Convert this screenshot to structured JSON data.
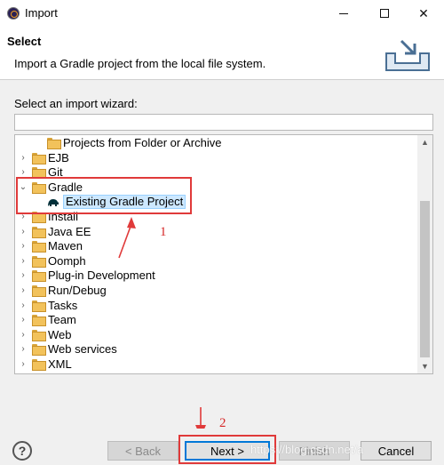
{
  "window": {
    "title": "Import",
    "minimize_icon": "minimize-icon",
    "maximize_icon": "maximize-icon",
    "close_glyph": "✕"
  },
  "header": {
    "title": "Select",
    "description": "Import a Gradle project from the local file system."
  },
  "wizard": {
    "label": "Select an import wizard:",
    "filter_value": ""
  },
  "tree": {
    "items": [
      {
        "label": "Projects from Folder or Archive",
        "level": 1,
        "twisty": "",
        "icon": "folder-icon"
      },
      {
        "label": "EJB",
        "level": 0,
        "twisty": "›",
        "icon": "folder-icon"
      },
      {
        "label": "Git",
        "level": 0,
        "twisty": "›",
        "icon": "folder-icon"
      },
      {
        "label": "Gradle",
        "level": 0,
        "twisty": "⌄",
        "icon": "folder-icon"
      },
      {
        "label": "Existing Gradle Project",
        "level": 1,
        "twisty": "",
        "icon": "gradle-elephant-icon",
        "selected": true
      },
      {
        "label": "Install",
        "level": 0,
        "twisty": "›",
        "icon": "folder-icon"
      },
      {
        "label": "Java EE",
        "level": 0,
        "twisty": "›",
        "icon": "folder-icon"
      },
      {
        "label": "Maven",
        "level": 0,
        "twisty": "›",
        "icon": "folder-icon"
      },
      {
        "label": "Oomph",
        "level": 0,
        "twisty": "›",
        "icon": "folder-icon"
      },
      {
        "label": "Plug-in Development",
        "level": 0,
        "twisty": "›",
        "icon": "folder-icon"
      },
      {
        "label": "Run/Debug",
        "level": 0,
        "twisty": "›",
        "icon": "folder-icon"
      },
      {
        "label": "Tasks",
        "level": 0,
        "twisty": "›",
        "icon": "folder-icon"
      },
      {
        "label": "Team",
        "level": 0,
        "twisty": "›",
        "icon": "folder-icon"
      },
      {
        "label": "Web",
        "level": 0,
        "twisty": "›",
        "icon": "folder-icon"
      },
      {
        "label": "Web services",
        "level": 0,
        "twisty": "›",
        "icon": "folder-icon"
      },
      {
        "label": "XML",
        "level": 0,
        "twisty": "›",
        "icon": "folder-icon"
      }
    ],
    "scroll_up": "▲",
    "scroll_down": "▼"
  },
  "annotations": {
    "one": "1",
    "two": "2",
    "color": "#e03a3a"
  },
  "buttons": {
    "help": "?",
    "back": "< Back",
    "next": "Next >",
    "finish": "Finish",
    "cancel": "Cancel"
  },
  "watermark": "https://blog.csdn.net/a"
}
